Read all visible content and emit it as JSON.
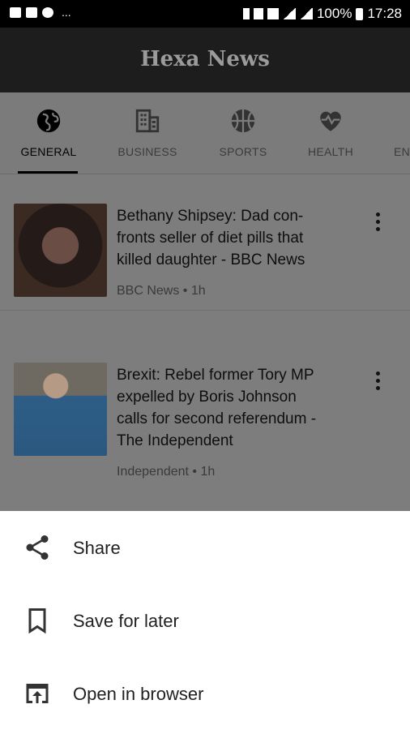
{
  "status_bar": {
    "overflow": "...",
    "battery": "100%",
    "time": "17:28"
  },
  "app": {
    "title": "Hexa News"
  },
  "tabs": [
    {
      "label": "GENERAL",
      "icon": "globe-icon",
      "active": true
    },
    {
      "label": "BUSINESS",
      "icon": "building-icon",
      "active": false
    },
    {
      "label": "SPORTS",
      "icon": "basketball-icon",
      "active": false
    },
    {
      "label": "HEALTH",
      "icon": "heart-pulse-icon",
      "active": false
    },
    {
      "label": "EN",
      "icon": "",
      "active": false
    }
  ],
  "articles": [
    {
      "title_lines": [
        "Bethany Shipsey: Dad con-",
        "fronts seller of diet pills that",
        "killed daughter - BBC News"
      ],
      "meta": "BBC News • 1h"
    },
    {
      "title_lines": [
        "Brexit: Rebel former Tory MP",
        "expelled by Boris Johnson",
        "calls for second referendum -",
        "The Independent"
      ],
      "meta": "Independent • 1h"
    }
  ],
  "sheet": {
    "items": [
      {
        "label": "Share",
        "icon": "share-icon"
      },
      {
        "label": "Save for later",
        "icon": "bookmark-icon"
      },
      {
        "label": "Open in browser",
        "icon": "open-in-browser-icon"
      }
    ]
  },
  "colors": {
    "app_bar": "#1d1d1d",
    "scrim_bg": "#7b7b7b",
    "sheet_bg": "#ffffff"
  }
}
